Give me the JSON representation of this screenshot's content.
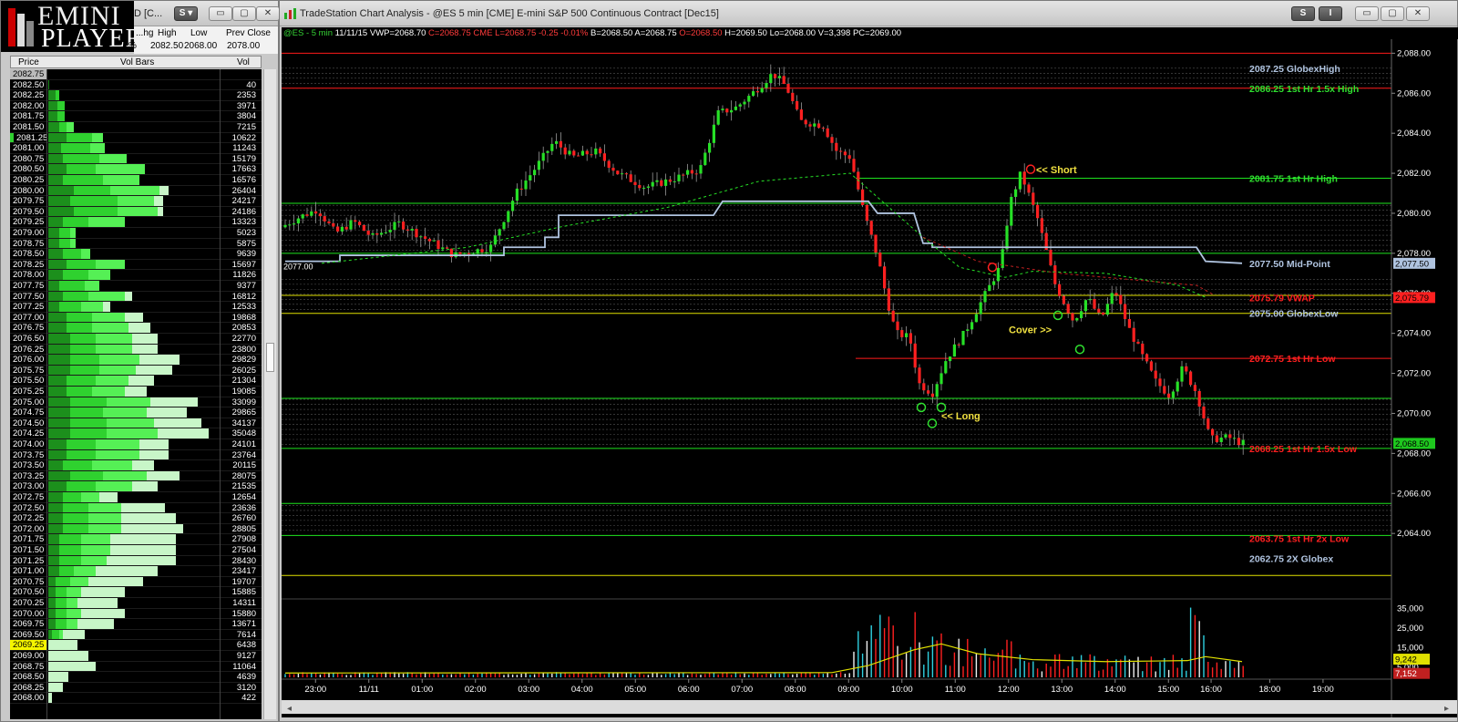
{
  "left_window": {
    "logo_top": "EMINI",
    "logo_bottom": "PLAYER",
    "title_fragment": "D [C...",
    "header_labels": [
      "...hg",
      "High",
      "Low",
      "Prev Close"
    ],
    "header_values": [
      "%",
      "2082.50",
      "2068.00",
      "2078.00"
    ],
    "ladder_header": {
      "price": "Price",
      "bars": "Vol Bars",
      "vol": "Vol"
    },
    "top_price": "2082.75",
    "rows": [
      {
        "p": "2082.50",
        "v": "40",
        "b": [
          0.005,
          0.0,
          0.0,
          0.0
        ],
        "hl": "none"
      },
      {
        "p": "2082.25",
        "v": "2353",
        "b": [
          0.04,
          0.02,
          0.0,
          0.0
        ],
        "hl": "none"
      },
      {
        "p": "2082.00",
        "v": "3971",
        "b": [
          0.05,
          0.04,
          0.0,
          0.0
        ],
        "hl": "none"
      },
      {
        "p": "2081.75",
        "v": "3804",
        "b": [
          0.05,
          0.04,
          0.0,
          0.0
        ],
        "hl": "none"
      },
      {
        "p": "2081.50",
        "v": "7215",
        "b": [
          0.06,
          0.04,
          0.04,
          0.0
        ],
        "hl": "none"
      },
      {
        "p": "2081.25",
        "v": "10622",
        "b": [
          0.1,
          0.14,
          0.06,
          0.0
        ],
        "hl": "g"
      },
      {
        "p": "2081.00",
        "v": "11243",
        "b": [
          0.07,
          0.16,
          0.08,
          0.0
        ],
        "hl": "none"
      },
      {
        "p": "2080.75",
        "v": "15179",
        "b": [
          0.08,
          0.2,
          0.15,
          0.0
        ],
        "hl": "none"
      },
      {
        "p": "2080.50",
        "v": "17663",
        "b": [
          0.1,
          0.16,
          0.27,
          0.0
        ],
        "hl": "none"
      },
      {
        "p": "2080.25",
        "v": "16576",
        "b": [
          0.08,
          0.22,
          0.2,
          0.0
        ],
        "hl": "none"
      },
      {
        "p": "2080.00",
        "v": "26404",
        "b": [
          0.14,
          0.2,
          0.27,
          0.05
        ],
        "hl": "none"
      },
      {
        "p": "2079.75",
        "v": "24217",
        "b": [
          0.12,
          0.26,
          0.2,
          0.05
        ],
        "hl": "none"
      },
      {
        "p": "2079.50",
        "v": "24186",
        "b": [
          0.14,
          0.24,
          0.22,
          0.03
        ],
        "hl": "none"
      },
      {
        "p": "2079.25",
        "v": "13323",
        "b": [
          0.08,
          0.14,
          0.2,
          0.0
        ],
        "hl": "none"
      },
      {
        "p": "2079.00",
        "v": "5023",
        "b": [
          0.06,
          0.06,
          0.03,
          0.0
        ],
        "hl": "none"
      },
      {
        "p": "2078.75",
        "v": "5875",
        "b": [
          0.06,
          0.06,
          0.03,
          0.0
        ],
        "hl": "none"
      },
      {
        "p": "2078.50",
        "v": "9639",
        "b": [
          0.08,
          0.1,
          0.05,
          0.0
        ],
        "hl": "none"
      },
      {
        "p": "2078.25",
        "v": "15697",
        "b": [
          0.1,
          0.16,
          0.16,
          0.0
        ],
        "hl": "none"
      },
      {
        "p": "2078.00",
        "v": "11826",
        "b": [
          0.08,
          0.14,
          0.12,
          0.0
        ],
        "hl": "none"
      },
      {
        "p": "2077.75",
        "v": "9377",
        "b": [
          0.06,
          0.14,
          0.08,
          0.0
        ],
        "hl": "none"
      },
      {
        "p": "2077.50",
        "v": "16812",
        "b": [
          0.08,
          0.14,
          0.2,
          0.04
        ],
        "hl": "none"
      },
      {
        "p": "2077.25",
        "v": "12533",
        "b": [
          0.06,
          0.12,
          0.12,
          0.04
        ],
        "hl": "none"
      },
      {
        "p": "2077.00",
        "v": "19868",
        "b": [
          0.1,
          0.14,
          0.18,
          0.1
        ],
        "hl": "none"
      },
      {
        "p": "2076.75",
        "v": "20853",
        "b": [
          0.1,
          0.14,
          0.2,
          0.12
        ],
        "hl": "none"
      },
      {
        "p": "2076.50",
        "v": "22770",
        "b": [
          0.12,
          0.14,
          0.2,
          0.14
        ],
        "hl": "none"
      },
      {
        "p": "2076.25",
        "v": "23800",
        "b": [
          0.12,
          0.14,
          0.2,
          0.14
        ],
        "hl": "none"
      },
      {
        "p": "2076.00",
        "v": "29829",
        "b": [
          0.12,
          0.16,
          0.22,
          0.22
        ],
        "hl": "none"
      },
      {
        "p": "2075.75",
        "v": "26025",
        "b": [
          0.12,
          0.16,
          0.2,
          0.2
        ],
        "hl": "none"
      },
      {
        "p": "2075.50",
        "v": "21304",
        "b": [
          0.1,
          0.16,
          0.18,
          0.14
        ],
        "hl": "none"
      },
      {
        "p": "2075.25",
        "v": "19085",
        "b": [
          0.1,
          0.14,
          0.18,
          0.12
        ],
        "hl": "none"
      },
      {
        "p": "2075.00",
        "v": "33099",
        "b": [
          0.12,
          0.2,
          0.24,
          0.26
        ],
        "hl": "none"
      },
      {
        "p": "2074.75",
        "v": "29865",
        "b": [
          0.12,
          0.18,
          0.24,
          0.22
        ],
        "hl": "none"
      },
      {
        "p": "2074.50",
        "v": "34137",
        "b": [
          0.12,
          0.2,
          0.26,
          0.26
        ],
        "hl": "none"
      },
      {
        "p": "2074.25",
        "v": "35048",
        "b": [
          0.12,
          0.2,
          0.28,
          0.28
        ],
        "hl": "none"
      },
      {
        "p": "2074.00",
        "v": "24101",
        "b": [
          0.1,
          0.16,
          0.24,
          0.16
        ],
        "hl": "none"
      },
      {
        "p": "2073.75",
        "v": "23764",
        "b": [
          0.1,
          0.16,
          0.24,
          0.16
        ],
        "hl": "none"
      },
      {
        "p": "2073.50",
        "v": "20115",
        "b": [
          0.08,
          0.16,
          0.22,
          0.12
        ],
        "hl": "none"
      },
      {
        "p": "2073.25",
        "v": "28075",
        "b": [
          0.12,
          0.18,
          0.24,
          0.18
        ],
        "hl": "none"
      },
      {
        "p": "2073.00",
        "v": "21535",
        "b": [
          0.1,
          0.16,
          0.2,
          0.14
        ],
        "hl": "none"
      },
      {
        "p": "2072.75",
        "v": "12654",
        "b": [
          0.08,
          0.1,
          0.1,
          0.1
        ],
        "hl": "none"
      },
      {
        "p": "2072.50",
        "v": "23636",
        "b": [
          0.08,
          0.14,
          0.18,
          0.24
        ],
        "hl": "none"
      },
      {
        "p": "2072.25",
        "v": "26760",
        "b": [
          0.08,
          0.14,
          0.18,
          0.3
        ],
        "hl": "none"
      },
      {
        "p": "2072.00",
        "v": "28805",
        "b": [
          0.08,
          0.14,
          0.18,
          0.34
        ],
        "hl": "none"
      },
      {
        "p": "2071.75",
        "v": "27908",
        "b": [
          0.06,
          0.12,
          0.16,
          0.36
        ],
        "hl": "none"
      },
      {
        "p": "2071.50",
        "v": "27504",
        "b": [
          0.06,
          0.12,
          0.16,
          0.36
        ],
        "hl": "none"
      },
      {
        "p": "2071.25",
        "v": "28430",
        "b": [
          0.06,
          0.12,
          0.14,
          0.38
        ],
        "hl": "none"
      },
      {
        "p": "2071.00",
        "v": "23417",
        "b": [
          0.06,
          0.08,
          0.12,
          0.34
        ],
        "hl": "none"
      },
      {
        "p": "2070.75",
        "v": "19707",
        "b": [
          0.04,
          0.08,
          0.1,
          0.3
        ],
        "hl": "none"
      },
      {
        "p": "2070.50",
        "v": "15885",
        "b": [
          0.04,
          0.06,
          0.08,
          0.24
        ],
        "hl": "none"
      },
      {
        "p": "2070.25",
        "v": "14311",
        "b": [
          0.04,
          0.06,
          0.06,
          0.22
        ],
        "hl": "none"
      },
      {
        "p": "2070.00",
        "v": "15880",
        "b": [
          0.04,
          0.06,
          0.08,
          0.24
        ],
        "hl": "none"
      },
      {
        "p": "2069.75",
        "v": "13671",
        "b": [
          0.04,
          0.06,
          0.06,
          0.2
        ],
        "hl": "none"
      },
      {
        "p": "2069.50",
        "v": "7614",
        "b": [
          0.02,
          0.04,
          0.02,
          0.12
        ],
        "hl": "none"
      },
      {
        "p": "2069.25",
        "v": "6438",
        "b": [
          0.0,
          0.0,
          0.0,
          0.16
        ],
        "hl": "y"
      },
      {
        "p": "2069.00",
        "v": "9127",
        "b": [
          0.0,
          0.0,
          0.0,
          0.22
        ],
        "hl": "none"
      },
      {
        "p": "2068.75",
        "v": "11064",
        "b": [
          0.0,
          0.0,
          0.0,
          0.26
        ],
        "hl": "none"
      },
      {
        "p": "2068.50",
        "v": "4639",
        "b": [
          0.0,
          0.0,
          0.0,
          0.11
        ],
        "hl": "none"
      },
      {
        "p": "2068.25",
        "v": "3120",
        "b": [
          0.0,
          0.0,
          0.0,
          0.08
        ],
        "hl": "none"
      },
      {
        "p": "2068.00",
        "v": "422",
        "b": [
          0.0,
          0.0,
          0.0,
          0.02
        ],
        "hl": "none"
      }
    ],
    "bar_colors": [
      "#1c8f1c",
      "#2fd12f",
      "#55f055",
      "#c8f6c8"
    ]
  },
  "chart_window": {
    "title": "TradeStation Chart Analysis - @ES 5 min [CME] E-mini S&P 500 Continuous Contract [Dec15]",
    "status": [
      {
        "t": "@ES - 5 min",
        "c": "#34d134"
      },
      {
        "t": "11/11/15",
        "c": "#ffffff"
      },
      {
        "t": "VWP=2068.70",
        "c": "#ffffff"
      },
      {
        "t": "C=2068.75",
        "c": "#ff3b3b"
      },
      {
        "t": "CME",
        "c": "#ff3b3b"
      },
      {
        "t": "L=2068.75",
        "c": "#ff3b3b"
      },
      {
        "t": "-0.25",
        "c": "#ff3b3b"
      },
      {
        "t": "-0.01%",
        "c": "#ff3b3b"
      },
      {
        "t": "B=2068.50",
        "c": "#ffffff"
      },
      {
        "t": "A=2068.75",
        "c": "#ffffff"
      },
      {
        "t": "O=2068.50",
        "c": "#ff3b3b"
      },
      {
        "t": "H=2069.50",
        "c": "#ffffff"
      },
      {
        "t": "Lo=2068.00",
        "c": "#ffffff"
      },
      {
        "t": "V=3,398",
        "c": "#ffffff"
      },
      {
        "t": "PC=2069.00",
        "c": "#ffffff"
      }
    ],
    "buttons": [
      "S",
      "I"
    ],
    "colors": {
      "up": "#26e026",
      "down": "#ff2020",
      "vwap": "#b0c4e0",
      "ma": "#26e026",
      "red_line": "#ff1a1a",
      "green_line": "#1ee31e",
      "yellow_line": "#e0e000"
    },
    "price_axis": [
      "2,088.00",
      "2,086.00",
      "2,084.00",
      "2,082.00",
      "2,080.00",
      "2,078.00",
      "2,076.00",
      "2,074.00",
      "2,072.00",
      "2,070.00",
      "2,068.00",
      "2,066.00",
      "2,064.00"
    ],
    "price_ticks": [
      2088,
      2086,
      2084,
      2082,
      2080,
      2078,
      2076,
      2074,
      2072,
      2070,
      2068,
      2066,
      2064
    ],
    "time_labels": [
      "23:00",
      "11/11",
      "01:00",
      "02:00",
      "03:00",
      "04:00",
      "05:00",
      "06:00",
      "07:00",
      "08:00",
      "09:00",
      "10:00",
      "11:00",
      "12:00",
      "13:00",
      "14:00",
      "15:00",
      "16:00",
      "18:00",
      "19:00"
    ],
    "time_index": [
      0.5,
      1.5,
      2.5,
      3.5,
      4.5,
      5.5,
      6.5,
      7.5,
      8.5,
      9.5,
      10.5,
      11.5,
      12.5,
      13.5,
      14.5,
      15.5,
      16.5,
      17.3,
      18.4,
      19.4
    ],
    "volume_axis": [
      "35,000",
      "25,000",
      "15,000",
      "5,000"
    ],
    "volume_ticks": [
      35000,
      25000,
      15000,
      5000
    ],
    "current_price_tag": "2,068.50",
    "midpoint_tag": "2,077.50",
    "vwap_tag": "2,075.79",
    "volume_tag": "9,242",
    "volume_tag2": "7,152",
    "prev_close_label": "2077.00",
    "levels": [
      {
        "price": 2087.25,
        "label": "2087.25 GlobexHigh",
        "color": "#b0c4e0"
      },
      {
        "price": 2086.25,
        "label": "2086.25 1st Hr 1.5x High",
        "color": "#2fe02f"
      },
      {
        "price": 2081.75,
        "label": "2081.75 1st Hr High",
        "color": "#2fe02f"
      },
      {
        "price": 2077.5,
        "label": "2077.50 Mid-Point",
        "color": "#b0c4e0"
      },
      {
        "price": 2075.79,
        "label": "2075.79 VWAP",
        "color": "#ff2020"
      },
      {
        "price": 2075.0,
        "label": "2075.00 GlobexLow",
        "color": "#b0c4e0"
      },
      {
        "price": 2072.75,
        "label": "2072.75 1st Hr Low",
        "color": "#ff2020"
      },
      {
        "price": 2068.25,
        "label": "2068.25 1st Hr 1.5x Low",
        "color": "#ff2020"
      },
      {
        "price": 2063.75,
        "label": "2063.75 1st Hr 2x Low",
        "color": "#ff2020"
      },
      {
        "price": 2062.75,
        "label": "2062.75 2X Globex",
        "color": "#b0c4e0"
      }
    ],
    "annotations": [
      {
        "text": "<< Short",
        "color": "#f0e040"
      },
      {
        "text": "Cover >>",
        "color": "#f0e040"
      },
      {
        "text": "<< Long",
        "color": "#f0e040"
      }
    ]
  }
}
